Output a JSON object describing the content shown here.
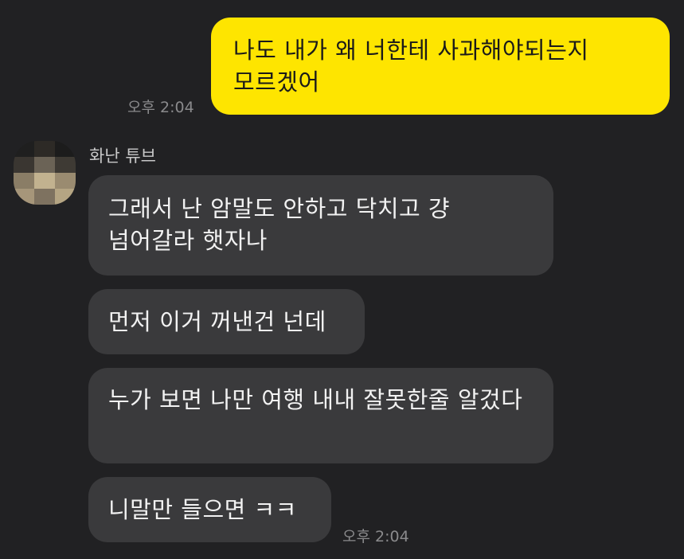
{
  "messages": {
    "outgoing": [
      {
        "text": "나도 내가 왜 너한테 사과해야되는지 모르겠어",
        "time": "오후 2:04"
      }
    ],
    "incoming": {
      "sender": "화난 튜브",
      "avatar_icon": "pixelated-avatar",
      "items": [
        {
          "text": "그래서 난 암말도 안하고 닥치고 걍 넘어갈라 햇자나"
        },
        {
          "text": "먼저 이거 꺼낸건 넌데"
        },
        {
          "text": "누가 보면 나만 여행 내내 잘못한줄 알겄다"
        },
        {
          "text": "니말만 들으면 ㅋㅋ"
        }
      ],
      "time": "오후 2:04"
    }
  },
  "colors": {
    "background": "#212123",
    "outgoing_bubble": "#fee500",
    "incoming_bubble": "#3a3a3c"
  }
}
